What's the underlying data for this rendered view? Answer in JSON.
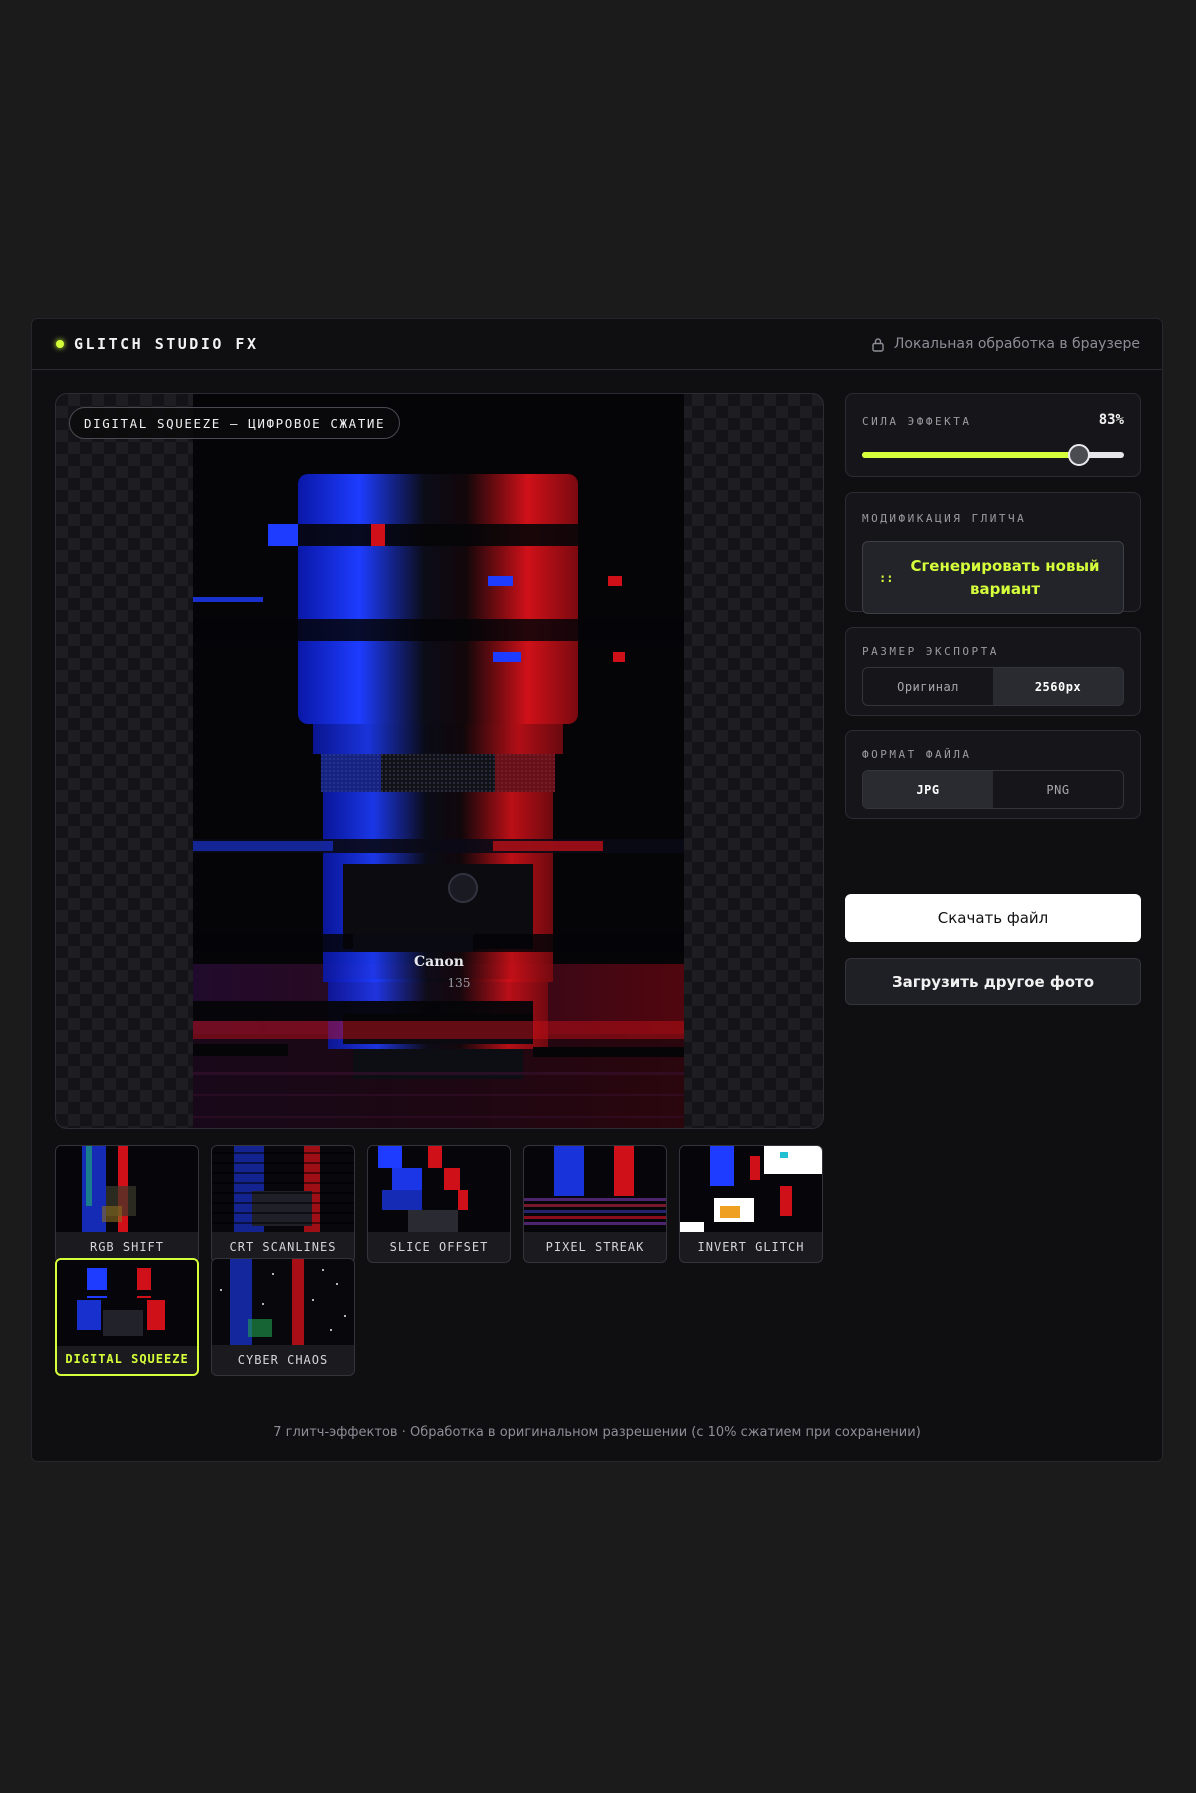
{
  "header": {
    "brand": "GLITCH STUDIO FX",
    "local_note": "Локальная обработка в браузере"
  },
  "viewer": {
    "effect_label": "DIGITAL SQUEEZE — ЦИФРОВОЕ СЖАТИЕ",
    "photo_text": {
      "brand": "Canon",
      "model": "135"
    }
  },
  "effects": [
    {
      "label": "RGB SHIFT",
      "active": false
    },
    {
      "label": "CRT SCANLINES",
      "active": false
    },
    {
      "label": "SLICE OFFSET",
      "active": false
    },
    {
      "label": "PIXEL STREAK",
      "active": false
    },
    {
      "label": "INVERT GLITCH",
      "active": false
    },
    {
      "label": "DIGITAL SQUEEZE",
      "active": true
    },
    {
      "label": "CYBER CHAOS",
      "active": false
    }
  ],
  "strength": {
    "title": "СИЛА ЭФФЕКТА",
    "value_label": "83%",
    "value": 0.83
  },
  "modify": {
    "title": "МОДИФИКАЦИЯ ГЛИТЧА",
    "icon": "::",
    "button": "Сгенерировать новый вариант"
  },
  "export_size": {
    "title": "РАЗМЕР ЭКСПОРТА",
    "options": [
      "Оригинал",
      "2560px"
    ],
    "selected": "2560px"
  },
  "file_format": {
    "title": "ФОРМАТ ФАЙЛА",
    "options": [
      "JPG",
      "PNG"
    ],
    "selected": "JPG"
  },
  "actions": {
    "download": "Скачать файл",
    "upload": "Загрузить другое фото"
  },
  "footer": "7 глитч-эффектов · Обработка в оригинальном разрешении (с 10% сжатием при сохранении)",
  "colors": {
    "accent": "#d4ff3a",
    "glitch_blue": "#1a3cff",
    "glitch_red": "#e0101c"
  }
}
